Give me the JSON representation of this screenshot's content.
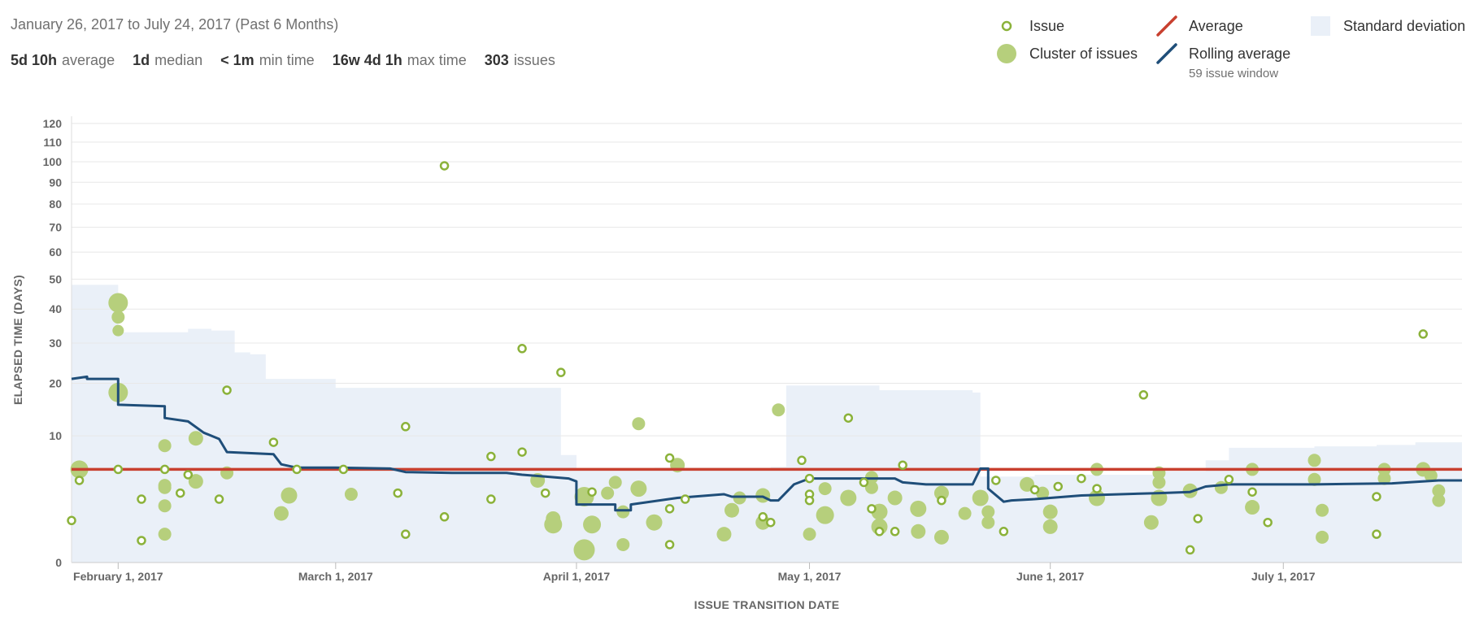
{
  "header": {
    "date_range": "January 26, 2017 to July 24, 2017 (Past 6 Months)",
    "stats": [
      {
        "value": "5d 10h",
        "label": "average"
      },
      {
        "value": "1d",
        "label": "median"
      },
      {
        "value": "< 1m",
        "label": "min time"
      },
      {
        "value": "16w 4d 1h",
        "label": "max time"
      },
      {
        "value": "303",
        "label": "issues"
      }
    ]
  },
  "legend": {
    "issue": "Issue",
    "cluster": "Cluster of issues",
    "average": "Average",
    "rolling": "Rolling average",
    "rolling_sub": "59 issue window",
    "stddev": "Standard deviation"
  },
  "colors": {
    "issue": "#8bb23a",
    "cluster": "#b6cf7c",
    "average": "#c8402f",
    "rolling": "#1f4e79",
    "stddev": "#eaf0f8",
    "grid": "#e8e8e8"
  },
  "chart_data": {
    "type": "scatter",
    "xlabel": "ISSUE TRANSITION DATE",
    "ylabel": "ELAPSED TIME (DAYS)",
    "xlim": [
      "2017-01-26",
      "2017-07-24"
    ],
    "y_scale": "sqrt",
    "ylim": [
      0,
      124
    ],
    "y_ticks": [
      0,
      10,
      20,
      30,
      40,
      50,
      60,
      70,
      80,
      90,
      100,
      110,
      120
    ],
    "x_ticks": [
      {
        "date": "2017-02-01",
        "label": "February 1, 2017"
      },
      {
        "date": "2017-03-01",
        "label": "March 1, 2017"
      },
      {
        "date": "2017-04-01",
        "label": "April 1, 2017"
      },
      {
        "date": "2017-05-01",
        "label": "May 1, 2017"
      },
      {
        "date": "2017-06-01",
        "label": "June 1, 2017"
      },
      {
        "date": "2017-07-01",
        "label": "July 1, 2017"
      }
    ],
    "average": 5.4,
    "issues": [
      [
        "2017-01-26",
        1.1
      ],
      [
        "2017-01-27",
        4.2
      ],
      [
        "2017-02-01",
        5.4
      ],
      [
        "2017-02-04",
        2.5
      ],
      [
        "2017-02-04",
        0.3
      ],
      [
        "2017-02-07",
        5.4
      ],
      [
        "2017-02-09",
        3.0
      ],
      [
        "2017-02-10",
        4.8
      ],
      [
        "2017-02-14",
        2.5
      ],
      [
        "2017-02-15",
        18.5
      ],
      [
        "2017-02-21",
        9.0
      ],
      [
        "2017-02-24",
        5.4
      ],
      [
        "2017-03-02",
        5.4
      ],
      [
        "2017-03-09",
        3.0
      ],
      [
        "2017-03-10",
        11.5
      ],
      [
        "2017-03-10",
        0.5
      ],
      [
        "2017-03-15",
        98.0
      ],
      [
        "2017-03-15",
        1.3
      ],
      [
        "2017-03-21",
        7.0
      ],
      [
        "2017-03-21",
        2.5
      ],
      [
        "2017-03-25",
        7.6
      ],
      [
        "2017-03-25",
        28.5
      ],
      [
        "2017-03-28",
        3.0
      ],
      [
        "2017-03-30",
        22.5
      ],
      [
        "2017-04-03",
        3.1
      ],
      [
        "2017-04-13",
        6.8
      ],
      [
        "2017-04-13",
        1.8
      ],
      [
        "2017-04-13",
        0.2
      ],
      [
        "2017-04-15",
        2.5
      ],
      [
        "2017-04-25",
        1.3
      ],
      [
        "2017-04-26",
        1.0
      ],
      [
        "2017-04-30",
        6.5
      ],
      [
        "2017-05-01",
        4.4
      ],
      [
        "2017-05-01",
        2.9
      ],
      [
        "2017-05-01",
        2.4
      ],
      [
        "2017-05-06",
        13.0
      ],
      [
        "2017-05-08",
        4.0
      ],
      [
        "2017-05-09",
        1.8
      ],
      [
        "2017-05-10",
        0.6
      ],
      [
        "2017-05-12",
        0.6
      ],
      [
        "2017-05-13",
        5.9
      ],
      [
        "2017-05-18",
        2.4
      ],
      [
        "2017-05-25",
        4.2
      ],
      [
        "2017-05-26",
        0.6
      ],
      [
        "2017-05-30",
        3.3
      ],
      [
        "2017-06-02",
        3.6
      ],
      [
        "2017-06-05",
        4.4
      ],
      [
        "2017-06-07",
        3.4
      ],
      [
        "2017-06-13",
        17.5
      ],
      [
        "2017-06-19",
        0.1
      ],
      [
        "2017-06-20",
        1.2
      ],
      [
        "2017-06-24",
        4.3
      ],
      [
        "2017-06-27",
        3.1
      ],
      [
        "2017-06-29",
        1.0
      ],
      [
        "2017-07-13",
        0.5
      ],
      [
        "2017-07-13",
        2.7
      ],
      [
        "2017-07-19",
        32.5
      ]
    ],
    "clusters": [
      [
        "2017-01-27",
        5.4,
        11
      ],
      [
        "2017-02-01",
        42.0,
        12
      ],
      [
        "2017-02-01",
        37.5,
        8
      ],
      [
        "2017-02-01",
        33.5,
        7
      ],
      [
        "2017-02-01",
        18.0,
        12
      ],
      [
        "2017-02-07",
        2.0,
        8
      ],
      [
        "2017-02-07",
        0.5,
        8
      ],
      [
        "2017-02-07",
        8.5,
        8
      ],
      [
        "2017-02-07",
        3.5,
        8
      ],
      [
        "2017-02-07",
        3.7,
        8
      ],
      [
        "2017-02-11",
        4.1,
        9
      ],
      [
        "2017-02-11",
        9.6,
        9
      ],
      [
        "2017-02-15",
        5.0,
        8
      ],
      [
        "2017-02-23",
        2.8,
        10
      ],
      [
        "2017-02-22",
        1.5,
        9
      ],
      [
        "2017-03-03",
        2.9,
        8
      ],
      [
        "2017-03-27",
        4.2,
        9
      ],
      [
        "2017-03-29",
        1.2,
        9
      ],
      [
        "2017-03-29",
        0.9,
        11
      ],
      [
        "2017-04-02",
        2.7,
        12
      ],
      [
        "2017-04-02",
        0.1,
        13
      ],
      [
        "2017-04-03",
        0.9,
        11
      ],
      [
        "2017-04-05",
        3.0,
        8
      ],
      [
        "2017-04-06",
        4.0,
        8
      ],
      [
        "2017-04-07",
        1.6,
        8
      ],
      [
        "2017-04-07",
        0.2,
        8
      ],
      [
        "2017-04-09",
        3.4,
        10
      ],
      [
        "2017-04-09",
        12.0,
        8
      ],
      [
        "2017-04-11",
        1.0,
        10
      ],
      [
        "2017-04-14",
        5.9,
        9
      ],
      [
        "2017-04-20",
        0.5,
        9
      ],
      [
        "2017-04-21",
        1.7,
        9
      ],
      [
        "2017-04-22",
        2.6,
        8
      ],
      [
        "2017-04-25",
        2.8,
        9
      ],
      [
        "2017-04-25",
        1.0,
        9
      ],
      [
        "2017-04-27",
        14.5,
        8
      ],
      [
        "2017-05-01",
        0.5,
        8
      ],
      [
        "2017-05-03",
        1.4,
        11
      ],
      [
        "2017-05-03",
        3.4,
        8
      ],
      [
        "2017-05-06",
        2.6,
        10
      ],
      [
        "2017-05-09",
        3.5,
        8
      ],
      [
        "2017-05-09",
        4.5,
        8
      ],
      [
        "2017-05-10",
        1.6,
        10
      ],
      [
        "2017-05-10",
        0.8,
        10
      ],
      [
        "2017-05-12",
        2.6,
        9
      ],
      [
        "2017-05-15",
        1.8,
        10
      ],
      [
        "2017-05-15",
        0.6,
        9
      ],
      [
        "2017-05-18",
        0.4,
        9
      ],
      [
        "2017-05-18",
        3.0,
        9
      ],
      [
        "2017-05-21",
        1.5,
        8
      ],
      [
        "2017-05-23",
        2.6,
        10
      ],
      [
        "2017-05-24",
        1.6,
        8
      ],
      [
        "2017-05-24",
        1.0,
        8
      ],
      [
        "2017-05-29",
        3.8,
        9
      ],
      [
        "2017-05-31",
        3.0,
        8
      ],
      [
        "2017-06-01",
        1.6,
        9
      ],
      [
        "2017-06-01",
        0.8,
        9
      ],
      [
        "2017-06-07",
        2.6,
        10
      ],
      [
        "2017-06-07",
        5.4,
        8
      ],
      [
        "2017-06-14",
        1.0,
        9
      ],
      [
        "2017-06-15",
        5.0,
        8
      ],
      [
        "2017-06-15",
        4.0,
        8
      ],
      [
        "2017-06-15",
        2.6,
        10
      ],
      [
        "2017-06-19",
        3.2,
        9
      ],
      [
        "2017-06-23",
        3.5,
        8
      ],
      [
        "2017-06-27",
        1.9,
        9
      ],
      [
        "2017-06-27",
        5.4,
        8
      ],
      [
        "2017-07-05",
        4.3,
        8
      ],
      [
        "2017-07-05",
        6.5,
        8
      ],
      [
        "2017-07-06",
        0.4,
        8
      ],
      [
        "2017-07-06",
        1.7,
        8
      ],
      [
        "2017-07-14",
        4.4,
        8
      ],
      [
        "2017-07-14",
        5.4,
        8
      ],
      [
        "2017-07-19",
        5.4,
        9
      ],
      [
        "2017-07-20",
        4.7,
        8
      ],
      [
        "2017-07-21",
        3.2,
        8
      ],
      [
        "2017-07-21",
        2.4,
        8
      ]
    ],
    "rolling_average": [
      [
        "2017-01-26",
        21.0
      ],
      [
        "2017-01-28",
        21.5
      ],
      [
        "2017-01-28",
        21.0
      ],
      [
        "2017-02-01",
        21.0
      ],
      [
        "2017-02-01",
        15.5
      ],
      [
        "2017-02-07",
        15.2
      ],
      [
        "2017-02-07",
        13.0
      ],
      [
        "2017-02-10",
        12.4
      ],
      [
        "2017-02-12",
        10.5
      ],
      [
        "2017-02-14",
        9.5
      ],
      [
        "2017-02-15",
        7.6
      ],
      [
        "2017-02-21",
        7.3
      ],
      [
        "2017-02-22",
        6.0
      ],
      [
        "2017-02-24",
        5.6
      ],
      [
        "2017-03-01",
        5.6
      ],
      [
        "2017-03-08",
        5.5
      ],
      [
        "2017-03-10",
        5.1
      ],
      [
        "2017-03-16",
        5.0
      ],
      [
        "2017-03-23",
        5.0
      ],
      [
        "2017-03-25",
        4.8
      ],
      [
        "2017-03-28",
        4.6
      ],
      [
        "2017-03-31",
        4.4
      ],
      [
        "2017-04-01",
        4.1
      ],
      [
        "2017-04-01",
        2.1
      ],
      [
        "2017-04-06",
        2.1
      ],
      [
        "2017-04-06",
        1.7
      ],
      [
        "2017-04-08",
        1.7
      ],
      [
        "2017-04-08",
        2.1
      ],
      [
        "2017-04-14",
        2.6
      ],
      [
        "2017-04-20",
        2.9
      ],
      [
        "2017-04-21",
        2.7
      ],
      [
        "2017-04-25",
        2.7
      ],
      [
        "2017-04-26",
        2.4
      ],
      [
        "2017-04-27",
        2.4
      ],
      [
        "2017-04-29",
        3.8
      ],
      [
        "2017-05-01",
        4.4
      ],
      [
        "2017-05-08",
        4.4
      ],
      [
        "2017-05-12",
        4.4
      ],
      [
        "2017-05-13",
        4.0
      ],
      [
        "2017-05-16",
        3.8
      ],
      [
        "2017-05-22",
        3.8
      ],
      [
        "2017-05-23",
        5.5
      ],
      [
        "2017-05-24",
        5.5
      ],
      [
        "2017-05-24",
        3.4
      ],
      [
        "2017-05-26",
        2.3
      ],
      [
        "2017-05-27",
        2.4
      ],
      [
        "2017-05-30",
        2.5
      ],
      [
        "2017-06-01",
        2.6
      ],
      [
        "2017-06-05",
        2.8
      ],
      [
        "2017-06-10",
        2.9
      ],
      [
        "2017-06-15",
        3.0
      ],
      [
        "2017-06-19",
        3.1
      ],
      [
        "2017-06-21",
        3.6
      ],
      [
        "2017-06-24",
        3.8
      ],
      [
        "2017-07-05",
        3.8
      ],
      [
        "2017-07-15",
        3.9
      ],
      [
        "2017-07-21",
        4.2
      ],
      [
        "2017-07-24",
        4.2
      ]
    ],
    "std_dev_upper": [
      [
        "2017-01-26",
        48.0
      ],
      [
        "2017-01-31",
        48.0
      ],
      [
        "2017-02-01",
        33.0
      ],
      [
        "2017-02-10",
        33.0
      ],
      [
        "2017-02-10",
        34.0
      ],
      [
        "2017-02-13",
        33.5
      ],
      [
        "2017-02-16",
        27.5
      ],
      [
        "2017-02-18",
        27.0
      ],
      [
        "2017-02-20",
        21.0
      ],
      [
        "2017-03-01",
        19.0
      ],
      [
        "2017-03-30",
        18.0
      ],
      [
        "2017-03-30",
        7.2
      ],
      [
        "2017-04-01",
        5.4
      ],
      [
        "2017-04-11",
        5.6
      ],
      [
        "2017-04-26",
        5.7
      ],
      [
        "2017-04-28",
        19.5
      ],
      [
        "2017-05-10",
        18.5
      ],
      [
        "2017-05-22",
        18.0
      ],
      [
        "2017-05-23",
        4.6
      ],
      [
        "2017-05-30",
        4.8
      ],
      [
        "2017-06-15",
        5.2
      ],
      [
        "2017-06-21",
        6.5
      ],
      [
        "2017-06-24",
        8.2
      ],
      [
        "2017-07-05",
        8.4
      ],
      [
        "2017-07-13",
        8.6
      ],
      [
        "2017-07-18",
        9.0
      ],
      [
        "2017-07-24",
        10.0
      ]
    ]
  }
}
